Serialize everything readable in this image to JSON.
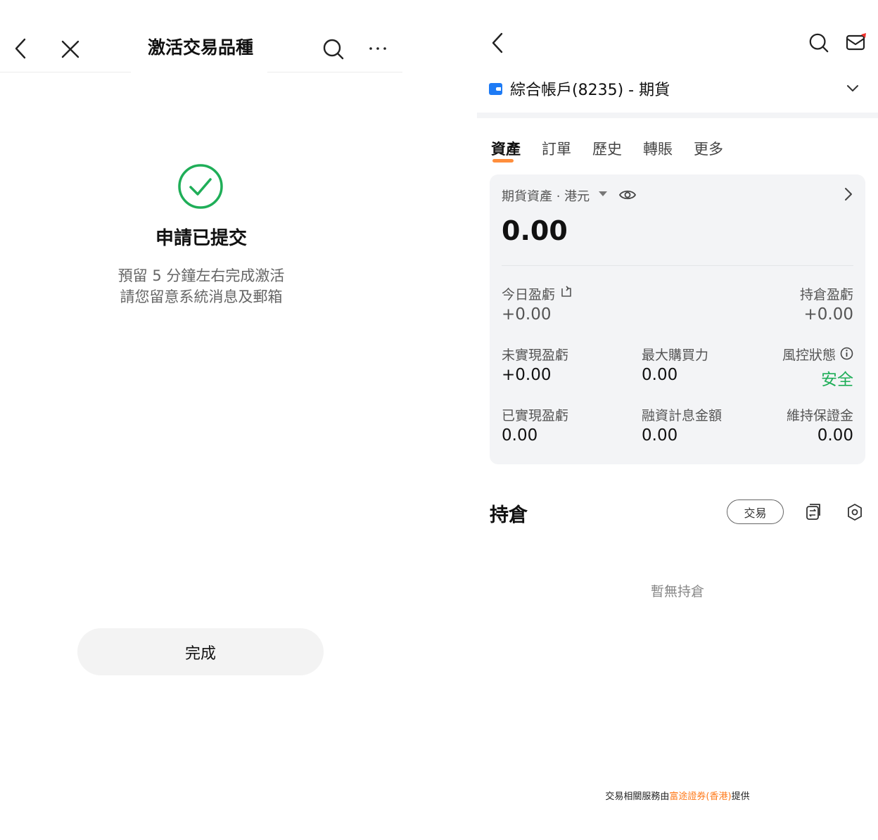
{
  "left": {
    "header": {
      "title": "激活交易品種"
    },
    "success": {
      "title": "申請已提交",
      "message_lines": [
        "預留 5 分鐘左右完成激活",
        "請您留意系統消息及郵箱"
      ]
    },
    "done_button": "完成"
  },
  "right": {
    "account": {
      "name": "綜合帳戶(8235) - 期貨"
    },
    "tabs": [
      {
        "label": "資產",
        "active": true
      },
      {
        "label": "訂單",
        "active": false
      },
      {
        "label": "歷史",
        "active": false
      },
      {
        "label": "轉賬",
        "active": false
      },
      {
        "label": "更多",
        "active": false
      }
    ],
    "assets": {
      "label": "期貨資產 · 港元",
      "total": "0.00",
      "metrics": [
        {
          "label": "今日盈虧",
          "value": "+0.00"
        },
        {
          "label": "持倉盈虧",
          "value": "+0.00"
        },
        {
          "label": "未實現盈虧",
          "value": "+0.00"
        },
        {
          "label": "最大購買力",
          "value": "0.00"
        },
        {
          "label": "風控狀態",
          "value": "安全"
        },
        {
          "label": "已實現盈虧",
          "value": "0.00"
        },
        {
          "label": "融資計息金額",
          "value": "0.00"
        },
        {
          "label": "維持保證金",
          "value": "0.00"
        }
      ]
    },
    "positions": {
      "title": "持倉",
      "trade_button": "交易",
      "empty_text": "暫無持倉"
    },
    "footer": {
      "prefix": "交易相關服務由",
      "provider": "富途證券(香港)",
      "suffix": "提供"
    }
  },
  "colors": {
    "success_green": "#1fae58",
    "accent_orange": "#ff7a1a",
    "brand_blue": "#1e7bf5",
    "notice_red": "#f0312c"
  }
}
